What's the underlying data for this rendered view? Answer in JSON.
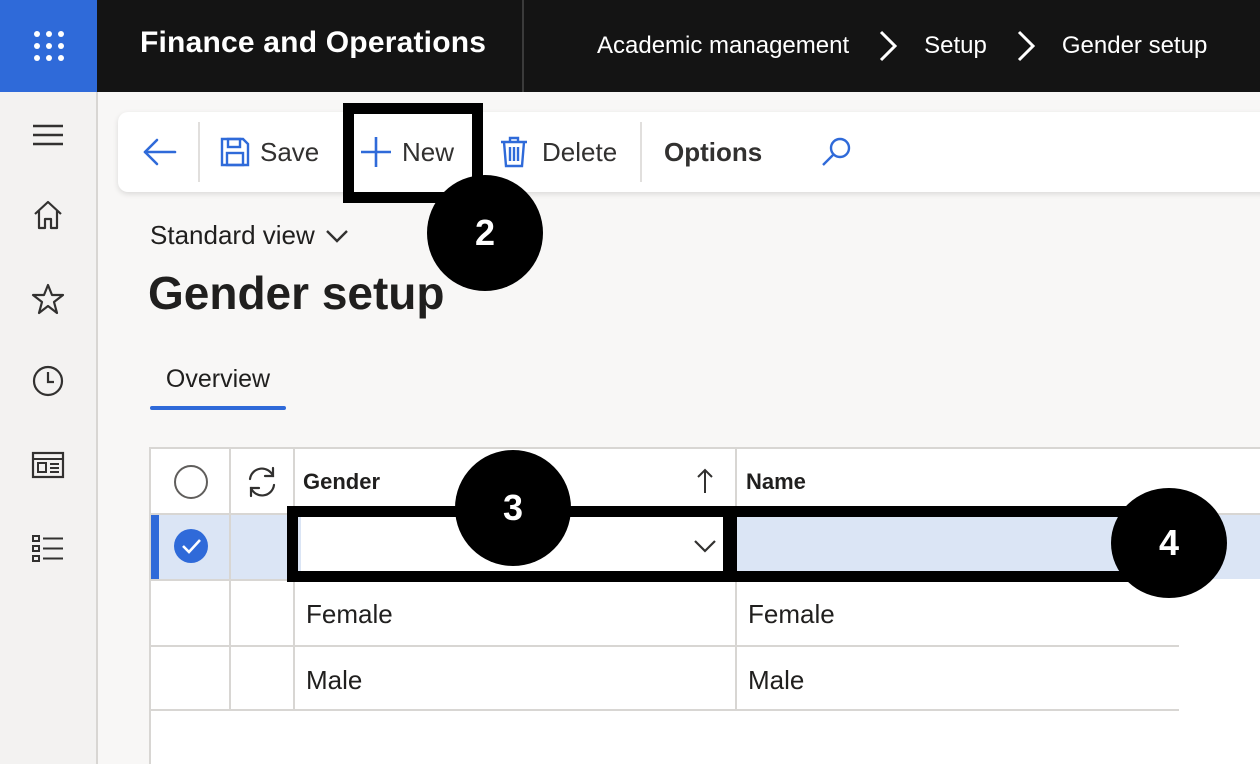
{
  "app": {
    "title": "Finance and Operations",
    "accent_color": "#2f6ad9",
    "topbar_color": "#141414"
  },
  "breadcrumb": [
    "Academic management",
    "Setup",
    "Gender setup"
  ],
  "leftnav": {
    "icons": [
      "hamburger-icon",
      "home-icon",
      "star-icon",
      "clock-icon",
      "workspace-icon",
      "list-icon"
    ]
  },
  "toolbar": {
    "save_label": "Save",
    "new_label": "New",
    "delete_label": "Delete",
    "options_label": "Options"
  },
  "view": {
    "selected": "Standard view"
  },
  "page": {
    "title": "Gender setup",
    "tab": "Overview"
  },
  "grid": {
    "columns": [
      "Gender",
      "Name"
    ],
    "rows": [
      {
        "gender": "",
        "name": "",
        "selected": true
      },
      {
        "gender": "Female",
        "name": "Female",
        "selected": false
      },
      {
        "gender": "Male",
        "name": "Male",
        "selected": false
      }
    ]
  },
  "annotations": {
    "markers": [
      "2",
      "3",
      "4"
    ]
  }
}
